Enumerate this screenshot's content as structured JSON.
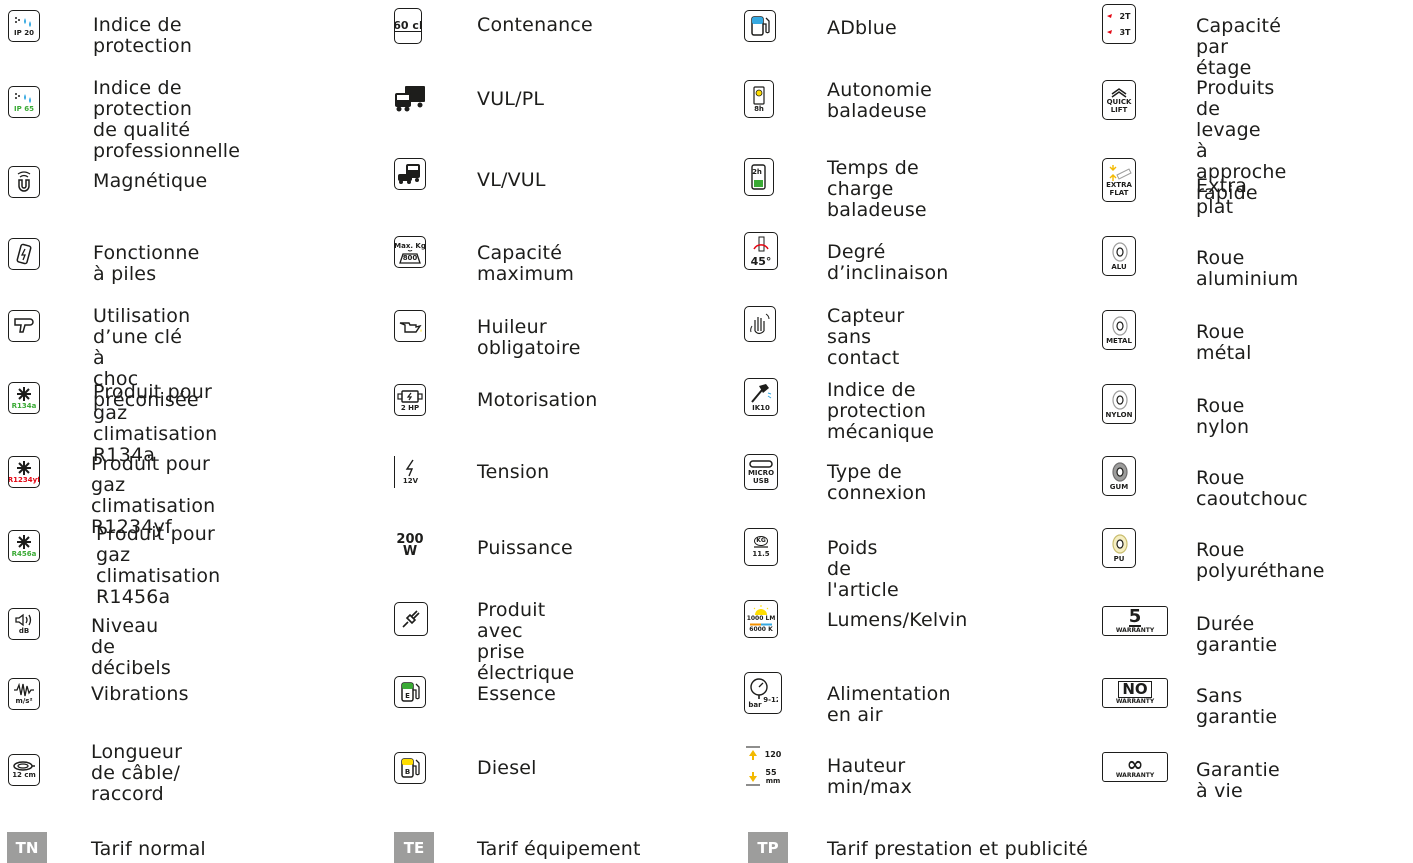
{
  "columns": [
    {
      "items": [
        {
          "icon": "ip20-icon",
          "icon_text": "IP 20",
          "label": "Indice de protection"
        },
        {
          "icon": "ip65-icon",
          "icon_text": "IP 65",
          "label": "Indice de protection\nde qualité\nprofessionnelle"
        },
        {
          "icon": "magnet-icon",
          "icon_text": "",
          "label": "Magnétique"
        },
        {
          "icon": "battery-icon",
          "icon_text": "",
          "label": "Fonctionne à piles"
        },
        {
          "icon": "impact-wrench-icon",
          "icon_text": "",
          "label": "Utilisation d’une clé à\nchoc préconisée"
        },
        {
          "icon": "snowflake-icon",
          "icon_text": "R134a",
          "label": "Produit pour gaz\nclimatisation R134a"
        },
        {
          "icon": "snowflake-icon",
          "icon_text": "R1234yf",
          "label": "Produit pour gaz\nclimatisation R1234yf"
        },
        {
          "icon": "snowflake-icon",
          "icon_text": "R456a",
          "label": "Produit pour gaz\nclimatisation R1456a"
        },
        {
          "icon": "speaker-icon",
          "icon_text": "dB",
          "label": "Niveau de décibels"
        },
        {
          "icon": "vibration-icon",
          "icon_text": "m/s²",
          "label": "Vibrations"
        },
        {
          "icon": "cable-reel-icon",
          "icon_text": "12 cm",
          "label": "Longueur de câble/\nraccord"
        }
      ]
    },
    {
      "items": [
        {
          "icon": "container-icon",
          "icon_text": "60 cl",
          "label": "Contenance"
        },
        {
          "icon": "truck-icon",
          "icon_text": "",
          "label": "VUL/PL"
        },
        {
          "icon": "van-car-icon",
          "icon_text": "",
          "label": "VL/VUL"
        },
        {
          "icon": "weight-icon",
          "icon_text": "Max. Kg",
          "icon_text2": "800",
          "label": "Capacité maximum"
        },
        {
          "icon": "oil-can-icon",
          "icon_text": "",
          "label": "Huileur obligatoire"
        },
        {
          "icon": "engine-icon",
          "icon_text": "2 HP",
          "label": "Motorisation"
        },
        {
          "icon": "lightning-icon",
          "icon_text": "12V",
          "label": "Tension"
        },
        {
          "icon": "power-icon",
          "icon_text": "200",
          "icon_text2": "W",
          "label": "Puissance"
        },
        {
          "icon": "plug-icon",
          "icon_text": "",
          "label": "Produit avec\nprise électrique"
        },
        {
          "icon": "fuel-pump-icon",
          "icon_text": "E",
          "label": "Essence"
        },
        {
          "icon": "fuel-pump-icon",
          "icon_text": "B",
          "label": "Diesel"
        }
      ]
    },
    {
      "items": [
        {
          "icon": "adblue-pump-icon",
          "icon_text": "",
          "label": "ADblue"
        },
        {
          "icon": "lamp-autonomy-icon",
          "icon_text": "8h",
          "label": "Autonomie\nbaladeuse"
        },
        {
          "icon": "charge-time-icon",
          "icon_text": "2h",
          "label": "Temps de charge\nbaladeuse"
        },
        {
          "icon": "tilt-angle-icon",
          "icon_text": "45°",
          "label": "Degré d’inclinaison"
        },
        {
          "icon": "hand-sensor-icon",
          "icon_text": "",
          "label": "Capteur sans\ncontact"
        },
        {
          "icon": "hammer-icon",
          "icon_text": "IK10",
          "label": "Indice de protection\nmécanique"
        },
        {
          "icon": "usb-icon",
          "icon_text": "MICRO",
          "icon_text2": "USB",
          "label": "Type de connexion"
        },
        {
          "icon": "kg-weight-icon",
          "icon_text": "KG",
          "icon_text2": "11.5",
          "label": "Poids de l'article"
        },
        {
          "icon": "sun-lumens-icon",
          "icon_text": "1000 LM",
          "icon_text2": "6000 K",
          "label": "Lumens/Kelvin"
        },
        {
          "icon": "pressure-gauge-icon",
          "icon_text": "bar",
          "icon_text2": "9-12",
          "label": "Alimentation en air"
        },
        {
          "icon": "height-arrows-icon",
          "icon_text": "120",
          "icon_text2": "55",
          "icon_text3": "mm",
          "label": "Hauteur min/max"
        }
      ]
    },
    {
      "items": [
        {
          "icon": "floor-capacity-icon",
          "icon_text": "2T",
          "icon_text2": "3T",
          "label": "Capacité par étage"
        },
        {
          "icon": "quick-lift-icon",
          "icon_text": "QUICK",
          "icon_text2": "LIFT",
          "label": "Produits de levage\nà approche rapide"
        },
        {
          "icon": "extra-flat-icon",
          "icon_text": "EXTRA",
          "icon_text2": "FLAT",
          "label": "Extra plat"
        },
        {
          "icon": "wheel-icon",
          "icon_text": "ALU",
          "label": "Roue aluminium"
        },
        {
          "icon": "wheel-icon",
          "icon_text": "METAL",
          "label": "Roue métal"
        },
        {
          "icon": "wheel-icon",
          "icon_text": "NYLON",
          "label": "Roue nylon"
        },
        {
          "icon": "wheel-icon",
          "icon_text": "GUM",
          "label": "Roue caoutchouc"
        },
        {
          "icon": "wheel-icon",
          "icon_text": "PU",
          "label": "Roue polyuréthane"
        },
        {
          "icon": "warranty-icon",
          "icon_text": "5",
          "icon_text2": "WARRANTY",
          "label": "Durée garantie"
        },
        {
          "icon": "no-warranty-icon",
          "icon_text": "NO",
          "icon_text2": "WARRANTY",
          "label": "Sans garantie"
        },
        {
          "icon": "lifetime-warranty-icon",
          "icon_text": "∞",
          "icon_text2": "WARRANTY",
          "label": "Garantie à vie"
        }
      ]
    }
  ],
  "tarifs": [
    {
      "code": "TN",
      "label": "Tarif normal"
    },
    {
      "code": "TE",
      "label": "Tarif équipement"
    },
    {
      "code": "TP",
      "label": "Tarif prestation et publicité"
    }
  ],
  "colors": {
    "text": "#1d1d1b",
    "tag_bg": "#9d9d9c",
    "green": "#3aaa35",
    "red": "#e30613",
    "blue": "#36a9e1",
    "yellow": "#ffdd00"
  }
}
